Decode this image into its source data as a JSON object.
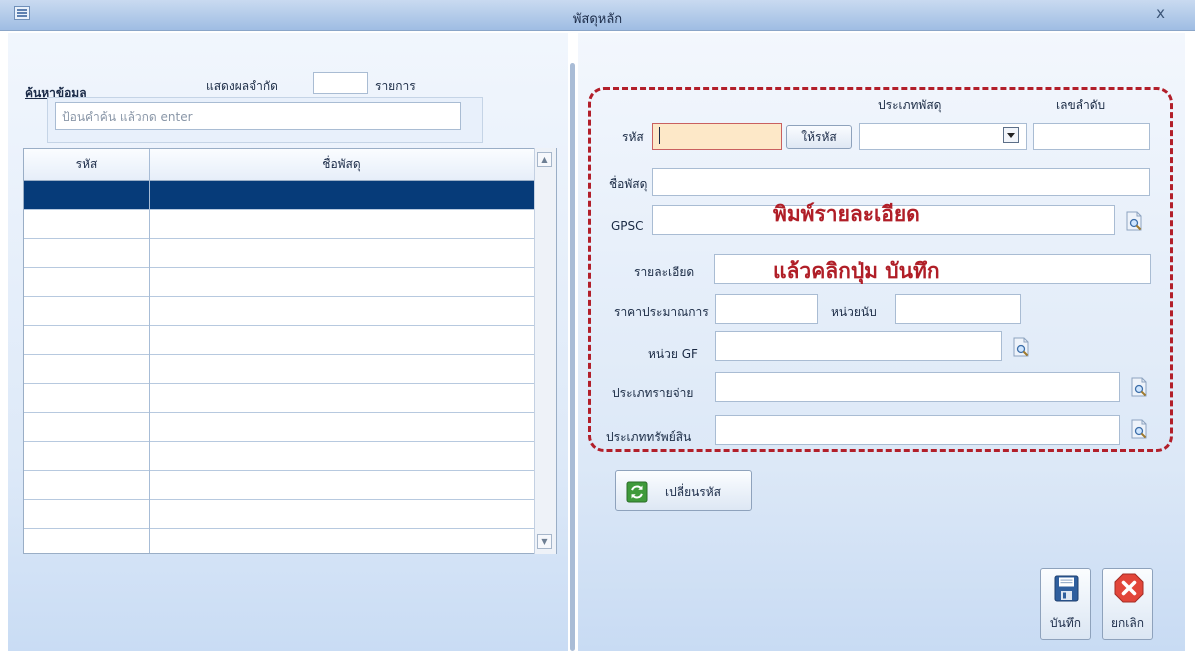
{
  "window": {
    "title": "พัสดุหลัก",
    "close_glyph": "x"
  },
  "search": {
    "link_label": "ค้นหาข้อมูล",
    "limit_label": "แสดงผลจำกัด",
    "limit_value": "",
    "limit_unit": "รายการ",
    "placeholder": "ป้อนคำค้น แล้วกด enter"
  },
  "grid": {
    "columns": [
      "รหัส",
      "ชื่อพัสดุ"
    ],
    "selected_row": 0
  },
  "form": {
    "type_header": "ประเภทพัสดุ",
    "seq_header": "เลขลำดับ",
    "code_label": "รหัส",
    "code_value": "",
    "gen_code_button": "ให้รหัส",
    "type_value": "",
    "seq_value": "",
    "name_label": "ชื่อพัสดุ",
    "name_value": "",
    "gpsc_label": "GPSC",
    "gpsc_value": "",
    "detail_label": "รายละเอียด",
    "detail_value": "",
    "price_label": "ราคาประมาณการ",
    "price_value": "",
    "unit_label": "หน่วยนับ",
    "unit_value": "",
    "gf_unit_label": "หน่วย GF",
    "gf_unit_value": "",
    "expense_type_label": "ประเภทรายจ่าย",
    "expense_type_value": "",
    "asset_type_label": "ประเภททรัพย์สิน",
    "asset_type_value": ""
  },
  "annotation": {
    "line1": "พิมพ์รายละเอียด",
    "line2": "แล้วคลิกปุ่ม บันทึก",
    "color": "#b01e27"
  },
  "actions": {
    "change_code_label": "เปลี่ยนรหัส",
    "save_label": "บันทึก",
    "cancel_label": "ยกเลิก"
  },
  "icons": {
    "window": "window-icon",
    "lookup": "magnifier-lookup-icon",
    "change_code": "refresh-icon",
    "save": "floppy-disk-icon",
    "cancel": "red-x-icon"
  }
}
